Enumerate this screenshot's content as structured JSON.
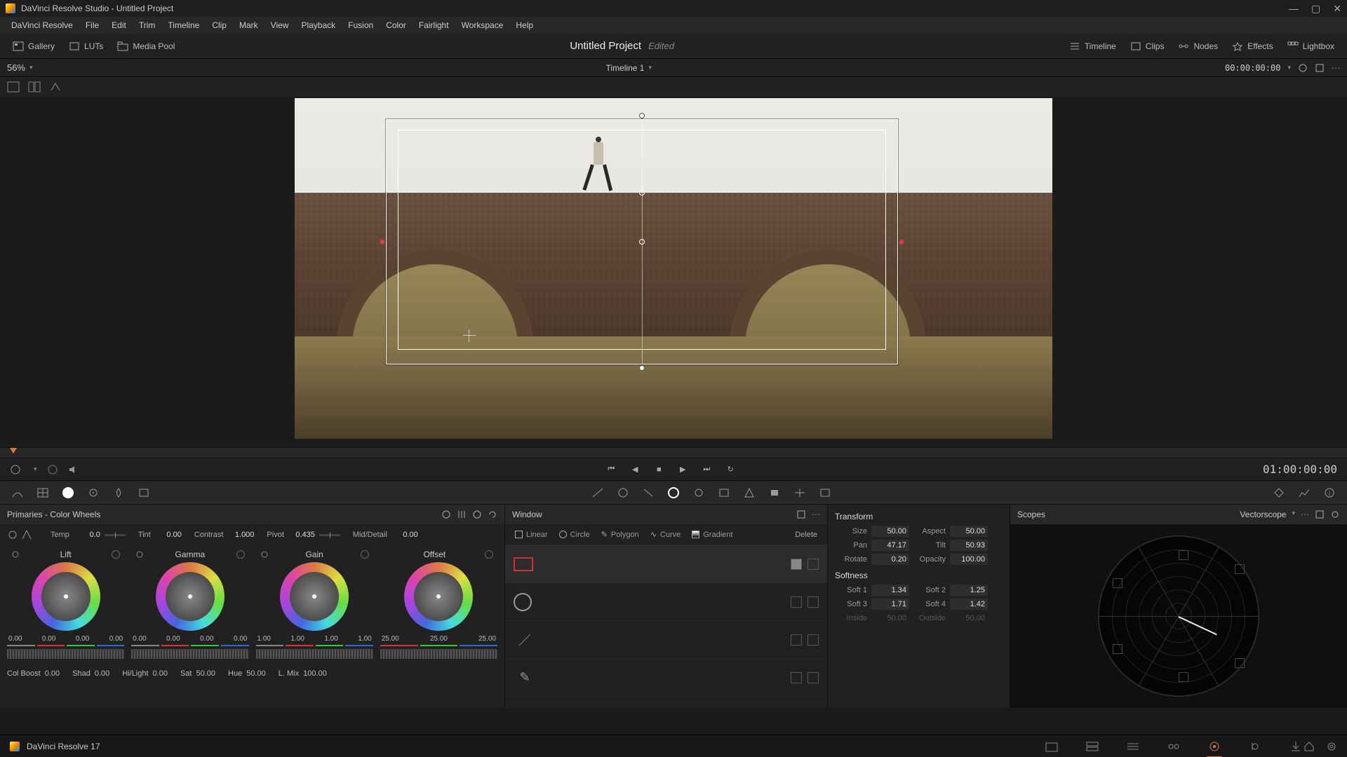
{
  "app": {
    "window_title": "DaVinci Resolve Studio - Untitled Project",
    "name": "DaVinci Resolve 17"
  },
  "menu": [
    "DaVinci Resolve",
    "File",
    "Edit",
    "Trim",
    "Timeline",
    "Clip",
    "Mark",
    "View",
    "Playback",
    "Fusion",
    "Color",
    "Fairlight",
    "Workspace",
    "Help"
  ],
  "toolbar": {
    "left": [
      "Gallery",
      "LUTs",
      "Media Pool"
    ],
    "project_title": "Untitled Project",
    "project_status": "Edited",
    "right": [
      "Timeline",
      "Clips",
      "Nodes",
      "Effects",
      "Lightbox"
    ]
  },
  "viewer": {
    "zoom": "56%",
    "timeline_name": "Timeline 1",
    "timecode_top": "00:00:00:00",
    "timecode_play": "01:00:00:00"
  },
  "primaries": {
    "title": "Primaries - Color Wheels",
    "adjust": {
      "temp": {
        "label": "Temp",
        "value": "0.0"
      },
      "tint": {
        "label": "Tint",
        "value": "0.00"
      },
      "contrast": {
        "label": "Contrast",
        "value": "1.000"
      },
      "pivot": {
        "label": "Pivot",
        "value": "0.435"
      },
      "middetail": {
        "label": "Mid/Detail",
        "value": "0.00"
      }
    },
    "wheels": {
      "lift": {
        "label": "Lift",
        "values": [
          "0.00",
          "0.00",
          "0.00",
          "0.00"
        ]
      },
      "gamma": {
        "label": "Gamma",
        "values": [
          "0.00",
          "0.00",
          "0.00",
          "0.00"
        ]
      },
      "gain": {
        "label": "Gain",
        "values": [
          "1.00",
          "1.00",
          "1.00",
          "1.00"
        ]
      },
      "offset": {
        "label": "Offset",
        "values": [
          "25.00",
          "25.00",
          "25.00"
        ]
      }
    },
    "bottom": {
      "colboost": {
        "label": "Col Boost",
        "value": "0.00"
      },
      "shad": {
        "label": "Shad",
        "value": "0.00"
      },
      "hilight": {
        "label": "Hi/Light",
        "value": "0.00"
      },
      "sat": {
        "label": "Sat",
        "value": "50.00"
      },
      "hue": {
        "label": "Hue",
        "value": "50.00"
      },
      "lmix": {
        "label": "L. Mix",
        "value": "100.00"
      }
    }
  },
  "window": {
    "title": "Window",
    "tabs": {
      "linear": "Linear",
      "circle": "Circle",
      "polygon": "Polygon",
      "curve": "Curve",
      "gradient": "Gradient",
      "delete": "Delete"
    }
  },
  "transform": {
    "title": "Transform",
    "size": {
      "label": "Size",
      "value": "50.00"
    },
    "aspect": {
      "label": "Aspect",
      "value": "50.00"
    },
    "pan": {
      "label": "Pan",
      "value": "47.17"
    },
    "tilt": {
      "label": "Tilt",
      "value": "50.93"
    },
    "rotate": {
      "label": "Rotate",
      "value": "0.20"
    },
    "opacity": {
      "label": "Opacity",
      "value": "100.00"
    },
    "softness_title": "Softness",
    "soft1": {
      "label": "Soft 1",
      "value": "1.34"
    },
    "soft2": {
      "label": "Soft 2",
      "value": "1.25"
    },
    "soft3": {
      "label": "Soft 3",
      "value": "1.71"
    },
    "soft4": {
      "label": "Soft 4",
      "value": "1.42"
    },
    "inside": {
      "label": "Inside",
      "value": "50.00"
    },
    "outside": {
      "label": "Outside",
      "value": "50.00"
    }
  },
  "scopes": {
    "title": "Scopes",
    "type": "Vectorscope"
  }
}
